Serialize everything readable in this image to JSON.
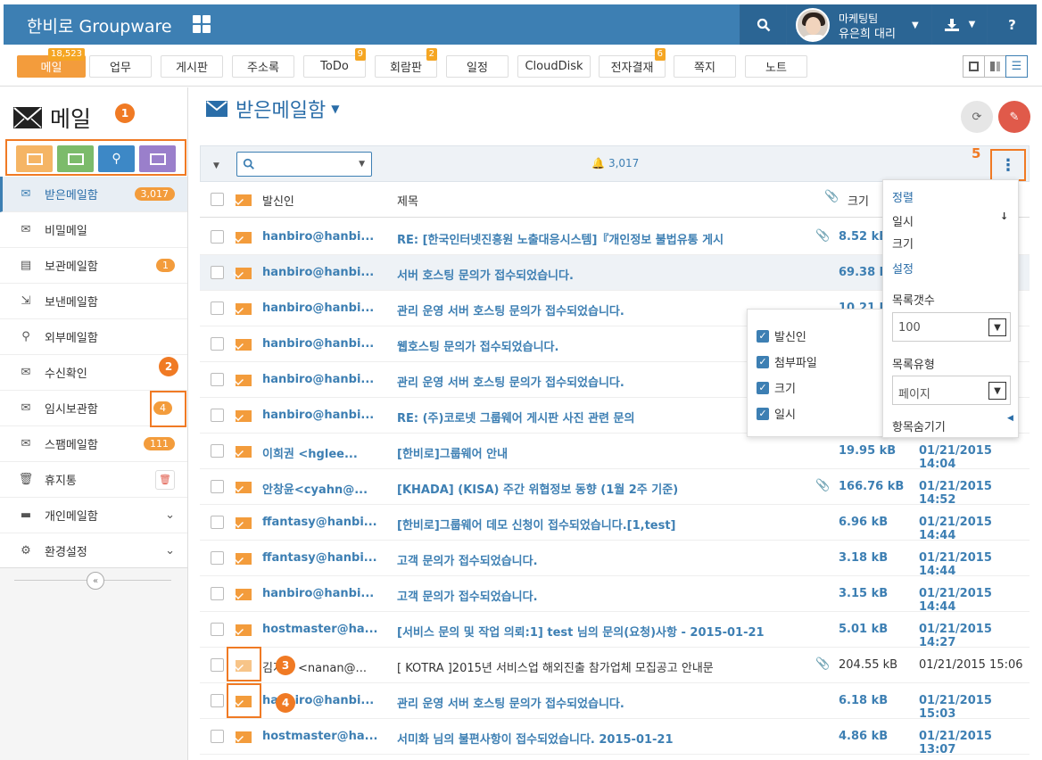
{
  "header": {
    "brand": "한비로 Groupware",
    "user_dept": "마케팅팀",
    "user_name": "유은희 대리",
    "help": "?"
  },
  "tabs": [
    {
      "label": "메일",
      "badge": "18,523",
      "active": true
    },
    {
      "label": "업무"
    },
    {
      "label": "게시판"
    },
    {
      "label": "주소록"
    },
    {
      "label": "ToDo",
      "badge": "9"
    },
    {
      "label": "회람판",
      "badge": "2"
    },
    {
      "label": "일정"
    },
    {
      "label": "CloudDisk"
    },
    {
      "label": "전자결재",
      "badge": "6"
    },
    {
      "label": "쪽지"
    },
    {
      "label": "노트"
    }
  ],
  "sidebar": {
    "title": "메일",
    "items": [
      {
        "label": "받은메일함",
        "count": "3,017",
        "icon": "inbox-icon"
      },
      {
        "label": "비밀메일",
        "icon": "lock-mail-icon"
      },
      {
        "label": "보관메일함",
        "count": "1",
        "icon": "archive-icon"
      },
      {
        "label": "보낸메일함",
        "icon": "sent-icon"
      },
      {
        "label": "외부메일함",
        "icon": "external-icon"
      },
      {
        "label": "수신확인",
        "icon": "receipt-icon"
      },
      {
        "label": "임시보관함",
        "count": "4",
        "icon": "draft-icon"
      },
      {
        "label": "스팸메일함",
        "count": "111",
        "icon": "spam-icon"
      },
      {
        "label": "휴지통",
        "icon": "trash-icon"
      },
      {
        "label": "개인메일함",
        "icon": "folder-icon"
      },
      {
        "label": "환경설정",
        "icon": "gear-icon"
      }
    ]
  },
  "annotations": {
    "n1": "1",
    "n2": "2",
    "n3": "3",
    "n4": "4",
    "n5": "5"
  },
  "main": {
    "title": "받은메일함",
    "notify_count": "3,017",
    "columns": {
      "from": "발신인",
      "subject": "제목",
      "size": "크기"
    }
  },
  "emails": [
    {
      "from": "hanbiro@hanbi...",
      "subject": "RE: [한국인터넷진흥원 노출대응시스템]『개인정보 불법유통 게시",
      "attach": true,
      "size": "8.52 kB",
      "date": ""
    },
    {
      "from": "hanbiro@hanbi...",
      "subject": "서버 호스팅 문의가 접수되었습니다.",
      "attach": false,
      "size": "69.38 kB",
      "date": ""
    },
    {
      "from": "hanbiro@hanbi...",
      "subject": "관리 운영 서버 호스팅 문의가 접수되었습니다.",
      "attach": false,
      "size": "10.21 kB",
      "date": ""
    },
    {
      "from": "hanbiro@hanbi...",
      "subject": "웹호스팅 문의가 접수되었습니다.",
      "attach": false,
      "size": "",
      "date": ""
    },
    {
      "from": "hanbiro@hanbi...",
      "subject": "관리 운영 서버 호스팅 문의가 접수되었습니다.",
      "attach": false,
      "size": "",
      "date": ""
    },
    {
      "from": "hanbiro@hanbi...",
      "subject": "RE: (주)코로넷 그룹웨어 게시판 사진 관련 문의",
      "attach": false,
      "size": "",
      "date": ""
    },
    {
      "from": "이희권 <hglee...",
      "subject": "[한비로]그룹웨어 안내",
      "attach": false,
      "size": "19.95 kB",
      "date": "01/21/2015 14:04"
    },
    {
      "from": "안창윤<cyahn@...",
      "subject": "[KHADA] (KISA) 주간 위협정보 동향 (1월 2주 기준)",
      "attach": true,
      "size": "166.76 kB",
      "date": "01/21/2015 14:52"
    },
    {
      "from": "ffantasy@hanbi...",
      "subject": "[한비로]그룹웨어 데모 신청이 접수되었습니다.[1,test]",
      "attach": false,
      "size": "6.96 kB",
      "date": "01/21/2015 14:44"
    },
    {
      "from": "ffantasy@hanbi...",
      "subject": "고객 문의가 접수되었습니다.",
      "attach": false,
      "size": "3.18 kB",
      "date": "01/21/2015 14:44"
    },
    {
      "from": "hanbiro@hanbi...",
      "subject": "고객 문의가 접수되었습니다.",
      "attach": false,
      "size": "3.15 kB",
      "date": "01/21/2015 14:44"
    },
    {
      "from": "hostmaster@ha...",
      "subject": "[서비스 문의 및 작업 의뢰:1] test 님의 문의(요청)사항 - 2015-01-21",
      "attach": false,
      "size": "5.01 kB",
      "date": "01/21/2015 14:27"
    },
    {
      "from": "김지나 <nanan@...",
      "subject": "[ KOTRA ]2015년 서비스업 해외진출 참가업체 모집공고 안내문",
      "attach": true,
      "size": "204.55 kB",
      "date": "01/21/2015 15:06",
      "read": true
    },
    {
      "from": "hanbiro@hanbi...",
      "subject": "관리 운영 서버 호스팅 문의가 접수되었습니다.",
      "attach": false,
      "size": "6.18 kB",
      "date": "01/21/2015 15:03"
    },
    {
      "from": "hostmaster@ha...",
      "subject": "서미화 님의 불편사항이 접수되었습니다. 2015-01-21",
      "attach": false,
      "size": "4.86 kB",
      "date": "01/21/2015 13:07"
    }
  ],
  "column_popup": {
    "items": [
      "발신인",
      "첨부파일",
      "크기",
      "일시"
    ]
  },
  "menu_popup": {
    "sort_header": "정렬",
    "sort_date": "일시",
    "sort_size": "크기",
    "settings_header": "설정",
    "list_count_label": "목록갯수",
    "list_count_value": "100",
    "list_type_label": "목록유형",
    "list_type_value": "페이지",
    "hide_items": "항목숨기기"
  },
  "colors": {
    "brand": "#3d7fb3",
    "accent": "#f39c3c",
    "highlight": "#f07a24"
  }
}
